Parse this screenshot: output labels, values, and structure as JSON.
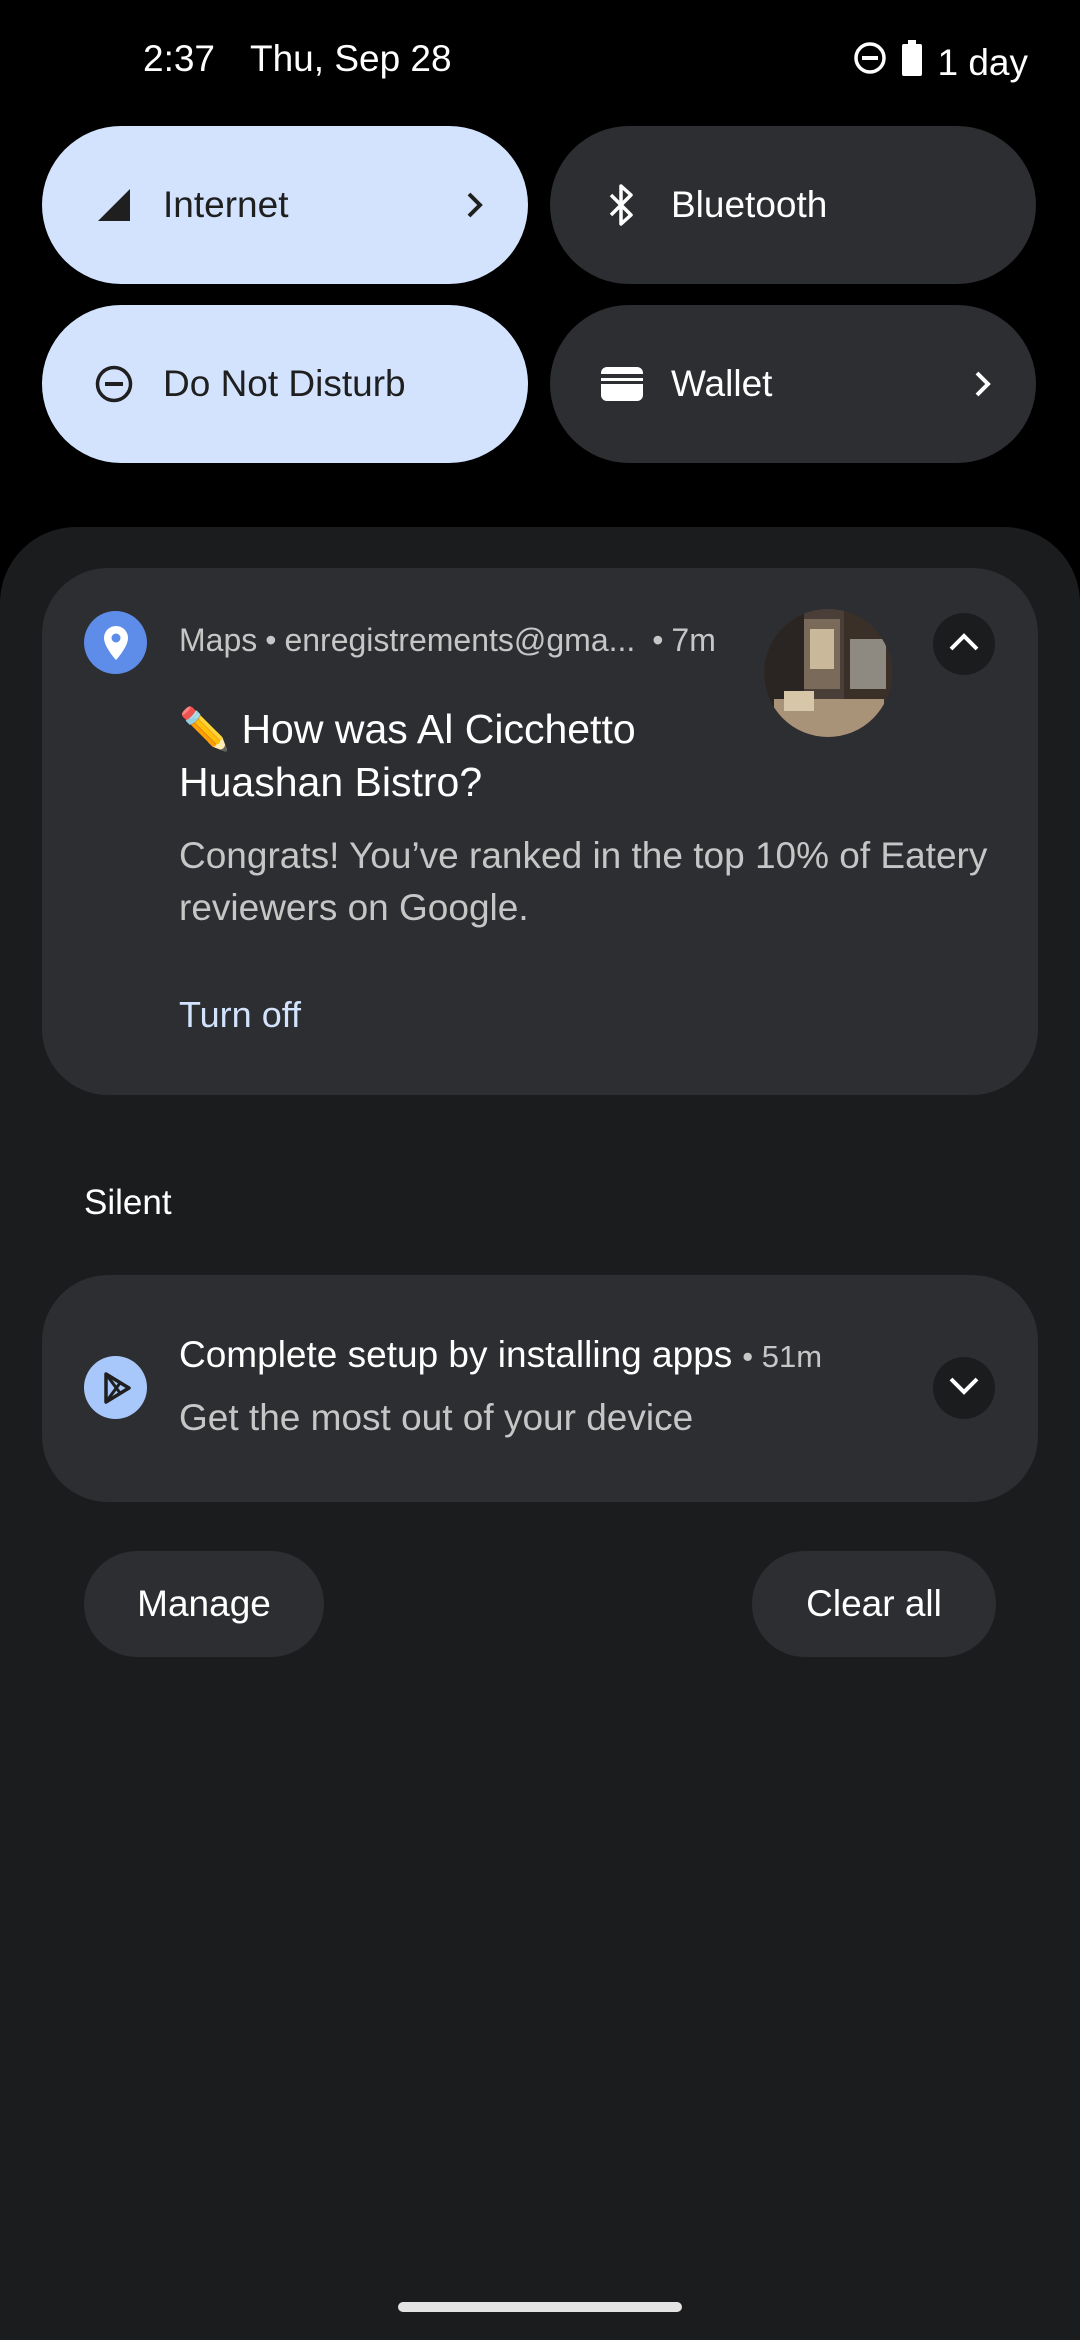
{
  "status_bar": {
    "time": "2:37",
    "date": "Thu, Sep 28",
    "battery_text": "1 day",
    "icons": [
      "do-not-disturb-icon",
      "battery-icon"
    ]
  },
  "quick_tiles": [
    {
      "label": "Internet",
      "icon": "signal-icon",
      "active": true,
      "has_chevron": true
    },
    {
      "label": "Bluetooth",
      "icon": "bluetooth-icon",
      "active": false,
      "has_chevron": false
    },
    {
      "label": "Do Not Disturb",
      "icon": "do-not-disturb-icon",
      "active": true,
      "has_chevron": false
    },
    {
      "label": "Wallet",
      "icon": "wallet-icon",
      "active": false,
      "has_chevron": true
    }
  ],
  "maps_notification": {
    "app": "Maps",
    "account": "enregistrements@gma...",
    "time": "7m",
    "title": "✏️ How was Al Cicchetto Huashan Bistro?",
    "body": "Congrats! You’ve ranked in the top 10% of Eatery reviewers on Google.",
    "action": "Turn off",
    "icon": "map-pin-icon"
  },
  "silent_section": {
    "label": "Silent"
  },
  "setup_notification": {
    "title": "Complete setup by installing apps",
    "time": "51m",
    "body": "Get the most out of your device",
    "icon": "play-store-icon"
  },
  "buttons": {
    "manage": "Manage",
    "clear_all": "Clear all"
  },
  "colors": {
    "tile_active": "#d3e3fd",
    "tile_inactive": "#2d2e31",
    "panel": "#1b1c1e",
    "card": "#2d2e31",
    "accent": "#5e8ce9"
  }
}
